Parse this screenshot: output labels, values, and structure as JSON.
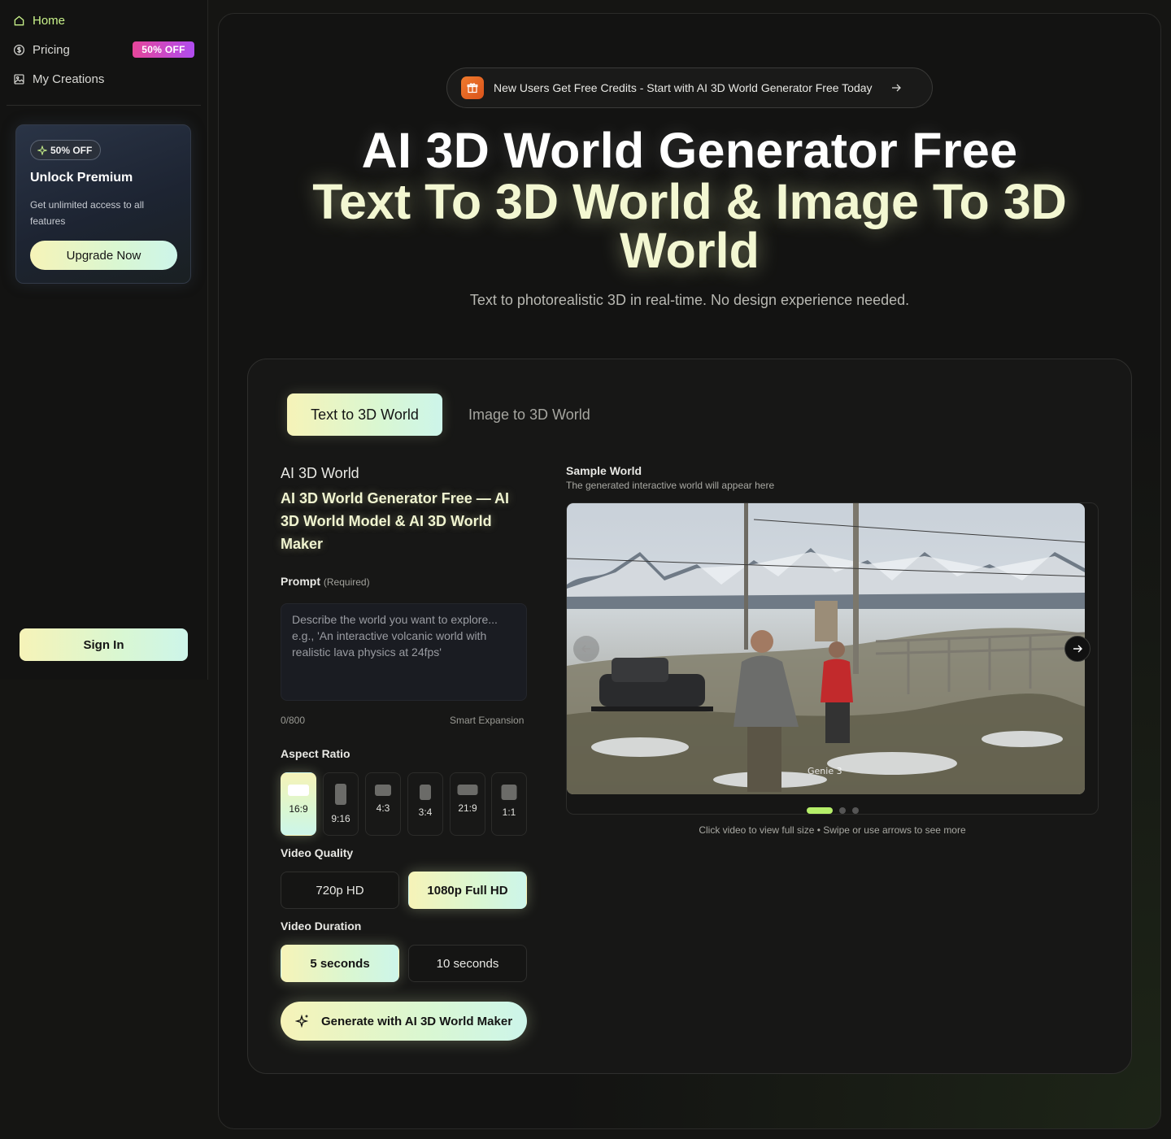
{
  "sidebar": {
    "nav": [
      {
        "label": "Home",
        "icon": "home-icon",
        "active": true
      },
      {
        "label": "Pricing",
        "icon": "dollar-circle-icon",
        "badge": "50% OFF"
      },
      {
        "label": "My Creations",
        "icon": "image-icon"
      }
    ],
    "premium": {
      "pill": "50% OFF",
      "title": "Unlock Premium",
      "description": "Get unlimited access to all features",
      "button": "Upgrade Now"
    },
    "sign_in": "Sign In"
  },
  "hero": {
    "announcement": "New Users Get Free Credits - Start with AI 3D World Generator Free Today",
    "title": "AI 3D World Generator Free",
    "subtitle_highlight": "Text To 3D World & Image To 3D World",
    "description": "Text to photorealistic 3D in real-time. No design experience needed."
  },
  "generator": {
    "tabs": [
      {
        "label": "Text to 3D World",
        "active": true
      },
      {
        "label": "Image to 3D World",
        "active": false
      }
    ],
    "heading": "AI 3D World",
    "subheading": "AI 3D World Generator Free — AI 3D World Model & AI 3D World Maker",
    "prompt": {
      "label": "Prompt",
      "required": "(Required)",
      "placeholder": "Describe the world you want to explore... e.g., 'An interactive volcanic world with realistic lava physics at 24fps'",
      "count": "0/800",
      "smart_expansion": "Smart Expansion"
    },
    "aspect_ratio": {
      "label": "Aspect Ratio",
      "options": [
        "16:9",
        "9:16",
        "4:3",
        "3:4",
        "21:9",
        "1:1"
      ],
      "selected": "16:9"
    },
    "video_quality": {
      "label": "Video Quality",
      "options": [
        "720p HD",
        "1080p Full HD"
      ],
      "selected": "1080p Full HD"
    },
    "video_duration": {
      "label": "Video Duration",
      "options": [
        "5 seconds",
        "10 seconds"
      ],
      "selected": "5 seconds"
    },
    "generate_button": "Generate with AI 3D World Maker"
  },
  "sample": {
    "title": "Sample World",
    "subtitle": "The generated interactive world will appear here",
    "watermark": "Genie 3",
    "slides_total": 3,
    "slide_active": 1,
    "caption": "Click video to view full size • Swipe or use arrows to see more"
  },
  "colors": {
    "accent_lime": "#c9f28a",
    "gradient_start": "#f6f3b8",
    "gradient_end": "#cdf5ea",
    "badge_pink": "#e6469a",
    "badge_purple": "#b04cf0",
    "gift_orange": "#f07b2d"
  }
}
